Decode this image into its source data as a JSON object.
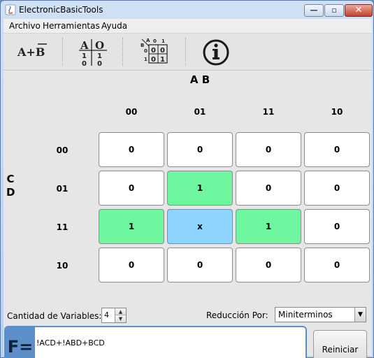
{
  "window": {
    "title": "ElectronicBasicTools"
  },
  "menu": [
    "Archivo",
    "Herramientas",
    "Ayuda"
  ],
  "toolbar": {
    "tools": [
      {
        "icon": "boolean-expression-icon",
        "label": "A+B"
      },
      {
        "icon": "truth-table-icon",
        "label": "A|O"
      },
      {
        "icon": "karnaugh-map-icon",
        "label": "K-map"
      },
      {
        "icon": "info-icon",
        "label": "i"
      }
    ]
  },
  "kmap": {
    "col_var_label": "A B",
    "row_var_label_c": "C",
    "row_var_label_d": "D",
    "col_headers": [
      "00",
      "01",
      "11",
      "10"
    ],
    "row_headers": [
      "00",
      "01",
      "11",
      "10"
    ],
    "cells": [
      [
        "0",
        "0",
        "0",
        "0"
      ],
      [
        "0",
        "1",
        "0",
        "0"
      ],
      [
        "1",
        "x",
        "1",
        "0"
      ],
      [
        "0",
        "0",
        "0",
        "0"
      ]
    ]
  },
  "controls": {
    "variables_label": "Cantidad de Variables:",
    "variables_value": "4",
    "reduction_label": "Reducción Por:",
    "reduction_value": "Miniterminos"
  },
  "result": {
    "prefix": "F=",
    "expression": "!ACD+!ABD+BCD"
  },
  "reset_label": "Reiniciar",
  "colors": {
    "one_cell": "#6ef5a0",
    "dontcare_cell": "#8fd3ff",
    "accent": "#5d8fca"
  }
}
